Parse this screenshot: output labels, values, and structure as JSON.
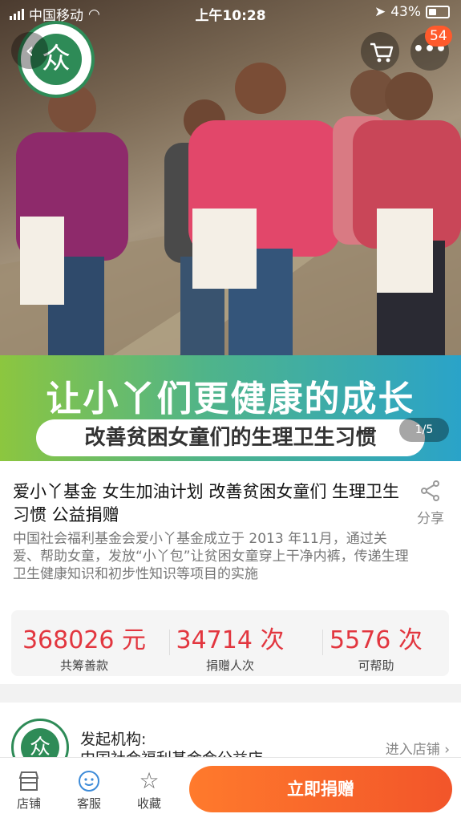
{
  "status_bar": {
    "carrier": "中国移动",
    "time": "上午10:28",
    "battery_percent": "43%"
  },
  "hero": {
    "logo_glyph": "众",
    "cart_badge": "54",
    "banner_title": "让小丫们更健康的成长",
    "banner_subtitle": "改善贫困女童们的生理卫生习惯",
    "pager": "1/5"
  },
  "product": {
    "title": "爱小丫基金 女生加油计划 改善贫困女童们 生理卫生习惯 公益捐赠",
    "share_label": "分享",
    "description": "中国社会福利基金会爱小丫基金成立于 2013 年11月，通过关爱、帮助女童，发放“小丫包”让贫困女童穿上干净内裤，传递生理卫生健康知识和初步性知识等项目的实施"
  },
  "stats": [
    {
      "value": "368026 元",
      "label": "共筹善款"
    },
    {
      "value": "34714 次",
      "label": "捐赠人次"
    },
    {
      "value": "5576 次",
      "label": "可帮助"
    }
  ],
  "organizer": {
    "label": "发起机构:",
    "name": "中国社会福利基金会公益店",
    "enter_label": "进入店铺"
  },
  "bottom_bar": {
    "shop_label": "店铺",
    "service_label": "客服",
    "favorite_label": "收藏",
    "donate_label": "立即捐赠"
  },
  "colors": {
    "accent_red": "#e2363f",
    "donate_orange": "#f2552a",
    "banner_green": "#8cc63f",
    "banner_blue": "#2aa3c9"
  }
}
